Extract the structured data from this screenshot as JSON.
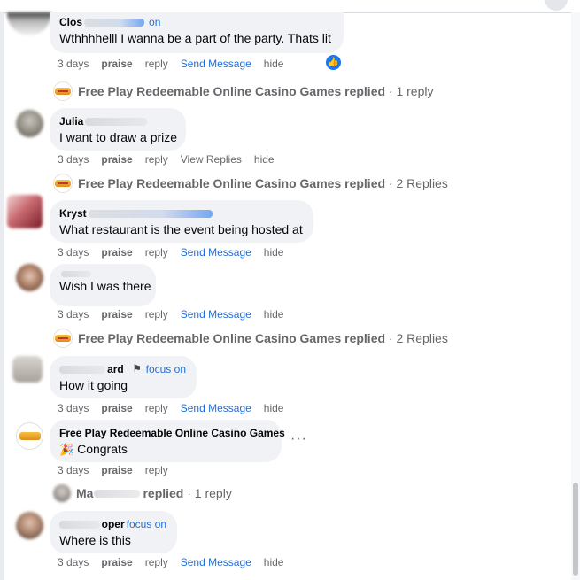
{
  "comments": [
    {
      "author": "Clos",
      "focus": "on",
      "text": "Wthhhhelll I wanna be a part of the party. Thats lit",
      "time": "3 days",
      "praise": "praise",
      "reply": "reply",
      "msg": "Send Message",
      "hide": "hide"
    },
    {
      "author": "Julia",
      "text": "I want to draw a prize",
      "time": "3 days",
      "praise": "praise",
      "reply": "reply",
      "msg": "View Replies",
      "hide": "hide"
    },
    {
      "author": "Kryst",
      "text": "What restaurant is the event being hosted at",
      "time": "3 days",
      "praise": "praise",
      "reply": "reply",
      "msg": "Send Message",
      "hide": "hide"
    },
    {
      "author": "",
      "text": "Wish I was there",
      "time": "3 days",
      "praise": "praise",
      "reply": "reply",
      "msg": "Send Message",
      "hide": "hide"
    },
    {
      "author": "ard",
      "focus": "focus on",
      "text": "How it going",
      "time": "3 days",
      "praise": "praise",
      "reply": "reply",
      "msg": "Send Message",
      "hide": "hide"
    },
    {
      "author": "Free Play Redeemable Online Casino Games",
      "text": "Congrats",
      "emoji": "🎉",
      "time": "3 days",
      "praise": "praise",
      "reply": "reply"
    },
    {
      "author": "oper",
      "focus": "focus on",
      "text": "Where is this",
      "time": "3 days",
      "praise": "praise",
      "reply": "reply",
      "msg": "Send Message",
      "hide": "hide"
    }
  ],
  "replies": [
    {
      "name": "Free Play Redeemable Online Casino Games replied",
      "count": "· 1 reply"
    },
    {
      "name": "Free Play Redeemable Online Casino Games replied",
      "count": "· 2 Replies"
    },
    {
      "name": "Free Play Redeemable Online Casino Games replied",
      "count": "· 2 Replies"
    },
    {
      "name": "Ma",
      "name2": "replied",
      "count": "· 1 reply"
    }
  ],
  "colors": {
    "link": "#216fdb",
    "bubble": "#f0f2f5",
    "meta": "#65676b"
  }
}
